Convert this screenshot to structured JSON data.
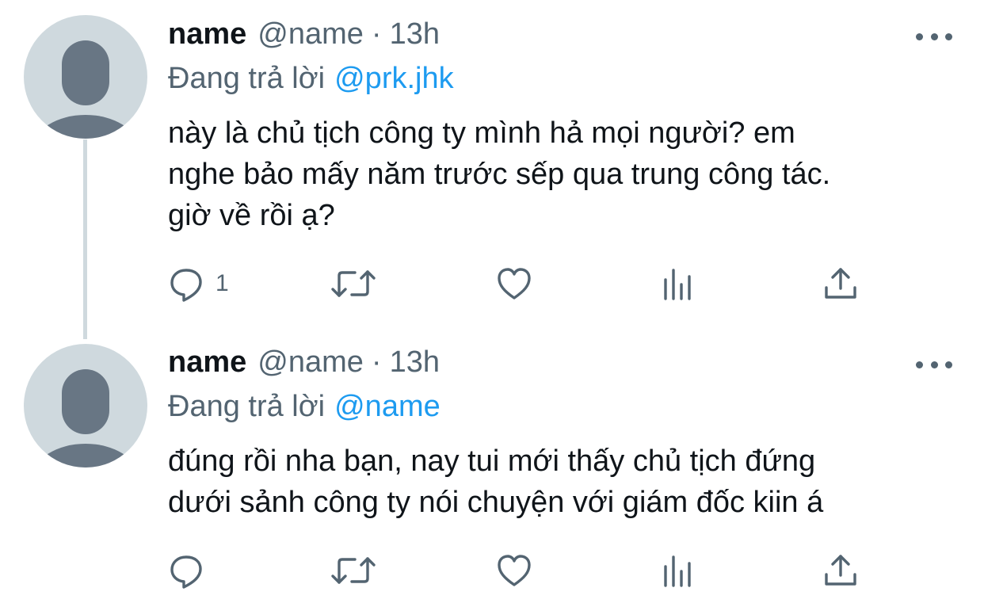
{
  "tweets": [
    {
      "display_name": "name",
      "handle": "@name",
      "separator": "·",
      "time": "13h",
      "reply_prefix": "Đang trả lời",
      "reply_to": "@prk.jhk",
      "text_lines": [
        "này là chủ tịch công ty mình hả mọi người? em",
        "nghe bảo mấy năm trước sếp qua trung công tác.",
        "giờ về rồi ạ?"
      ],
      "reply_count": "1"
    },
    {
      "display_name": "name",
      "handle": "@name",
      "separator": "·",
      "time": "13h",
      "reply_prefix": "Đang trả lời",
      "reply_to": "@name",
      "text_lines": [
        "đúng rồi nha bạn, nay tui mới thấy chủ tịch đứng",
        "dưới sảnh công ty nói chuyện với giám đốc kiin á"
      ],
      "reply_count": ""
    }
  ],
  "icons": {
    "reply": "speech-bubble-icon",
    "retweet": "retweet-arrows-icon",
    "like": "heart-outline-icon",
    "views": "bar-chart-icon",
    "share": "upload-arrow-icon",
    "more": "three-dots-icon",
    "avatar": "default-user-silhouette-icon"
  },
  "colors": {
    "text": "#0f1419",
    "secondary": "#536471",
    "link": "#1d9bf0",
    "avatar_bg": "#cfd9de",
    "avatar_fg": "#687684"
  }
}
